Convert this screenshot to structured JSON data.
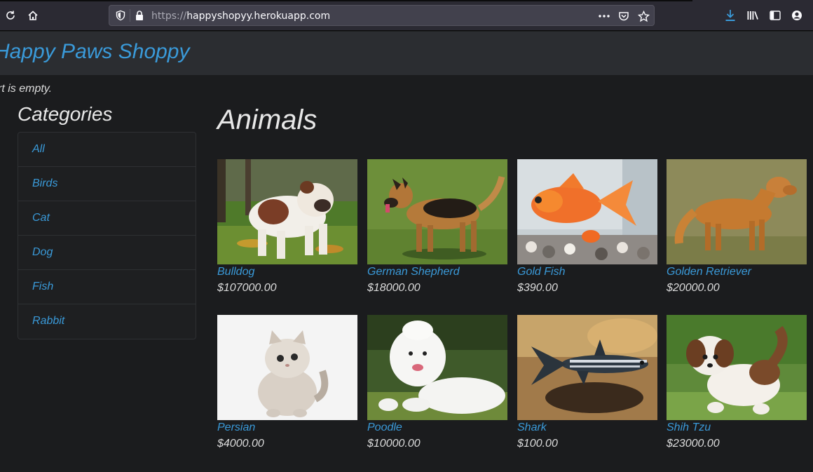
{
  "browser": {
    "url_protocol": "https://",
    "url_host": "happyshopyy.herokuapp.com",
    "icons": [
      "reload-icon",
      "home-icon",
      "shield-icon",
      "lock-icon",
      "more-icon",
      "pocket-icon",
      "bookmark-star-icon",
      "download-icon",
      "library-icon",
      "sidebar-icon",
      "account-icon"
    ]
  },
  "header": {
    "brand": "Happy Paws Shoppy"
  },
  "cart": {
    "status": "rt is empty."
  },
  "sidebar": {
    "title": "Categories",
    "items": [
      {
        "label": "All"
      },
      {
        "label": "Birds"
      },
      {
        "label": "Cat"
      },
      {
        "label": "Dog"
      },
      {
        "label": "Fish"
      },
      {
        "label": "Rabbit"
      }
    ]
  },
  "main": {
    "title": "Animals",
    "products": [
      {
        "name": "Bulldog",
        "price": "$107000.00"
      },
      {
        "name": "German Shepherd",
        "price": "$18000.00"
      },
      {
        "name": "Gold Fish",
        "price": "$390.00"
      },
      {
        "name": "Golden Retriever",
        "price": "$20000.00"
      },
      {
        "name": "Persian",
        "price": "$4000.00"
      },
      {
        "name": "Poodle",
        "price": "$10000.00"
      },
      {
        "name": "Shark",
        "price": "$100.00"
      },
      {
        "name": "Shih Tzu",
        "price": "$23000.00"
      }
    ]
  },
  "colors": {
    "link": "#3a9ad9",
    "header_bg": "#2b2d31",
    "page_bg": "#1b1c1e",
    "download_accent": "#3a9ad9"
  }
}
